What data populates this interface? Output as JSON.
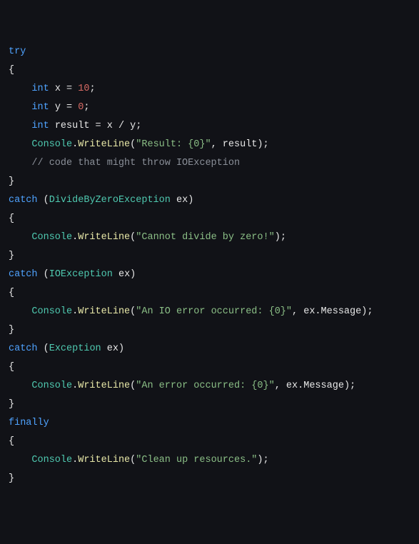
{
  "code": {
    "l1_try": "try",
    "l2_ob": "{",
    "l3_indent": "    ",
    "l3_type": "int",
    "l3_sp": " ",
    "l3_var": "x",
    "l3_eq": " = ",
    "l3_num": "10",
    "l3_semi": ";",
    "l4_indent": "    ",
    "l4_type": "int",
    "l4_sp": " ",
    "l4_var": "y",
    "l4_eq": " = ",
    "l4_num": "0",
    "l4_semi": ";",
    "l5_indent": "    ",
    "l5_type": "int",
    "l5_sp": " ",
    "l5_var": "result",
    "l5_eq": " = ",
    "l5_x": "x",
    "l5_div": " / ",
    "l5_y": "y",
    "l5_semi": ";",
    "l6_indent": "    ",
    "l6_cls": "Console",
    "l6_dot": ".",
    "l6_meth": "WriteLine",
    "l6_op": "(",
    "l6_str": "\"Result: {0}\"",
    "l6_comma": ", ",
    "l6_arg": "result",
    "l6_cp": ")",
    "l6_semi": ";",
    "l7_indent": "    ",
    "l7_comment": "// code that might throw IOException",
    "l8_cb": "}",
    "l9_catch": "catch",
    "l9_sp": " ",
    "l9_op": "(",
    "l9_cls": "DivideByZeroException",
    "l9_sp2": " ",
    "l9_ex": "ex",
    "l9_cp": ")",
    "l10_ob": "{",
    "l11_indent": "    ",
    "l11_cls": "Console",
    "l11_dot": ".",
    "l11_meth": "WriteLine",
    "l11_op": "(",
    "l11_str": "\"Cannot divide by zero!\"",
    "l11_cp": ")",
    "l11_semi": ";",
    "l12_cb": "}",
    "l13_catch": "catch",
    "l13_sp": " ",
    "l13_op": "(",
    "l13_cls": "IOException",
    "l13_sp2": " ",
    "l13_ex": "ex",
    "l13_cp": ")",
    "l14_ob": "{",
    "l15_indent": "    ",
    "l15_cls": "Console",
    "l15_dot": ".",
    "l15_meth": "WriteLine",
    "l15_op": "(",
    "l15_str": "\"An IO error occurred: {0}\"",
    "l15_comma": ", ",
    "l15_ex": "ex",
    "l15_dot2": ".",
    "l15_msg": "Message",
    "l15_cp": ")",
    "l15_semi": ";",
    "l16_cb": "}",
    "l17_catch": "catch",
    "l17_sp": " ",
    "l17_op": "(",
    "l17_cls": "Exception",
    "l17_sp2": " ",
    "l17_ex": "ex",
    "l17_cp": ")",
    "l18_ob": "{",
    "l19_indent": "    ",
    "l19_cls": "Console",
    "l19_dot": ".",
    "l19_meth": "WriteLine",
    "l19_op": "(",
    "l19_str": "\"An error occurred: {0}\"",
    "l19_comma": ", ",
    "l19_ex": "ex",
    "l19_dot2": ".",
    "l19_msg": "Message",
    "l19_cp": ")",
    "l19_semi": ";",
    "l20_cb": "}",
    "l21_finally": "finally",
    "l22_ob": "{",
    "l23_indent": "    ",
    "l23_cls": "Console",
    "l23_dot": ".",
    "l23_meth": "WriteLine",
    "l23_op": "(",
    "l23_str": "\"Clean up resources.\"",
    "l23_cp": ")",
    "l23_semi": ";",
    "l24_cb": "}"
  }
}
